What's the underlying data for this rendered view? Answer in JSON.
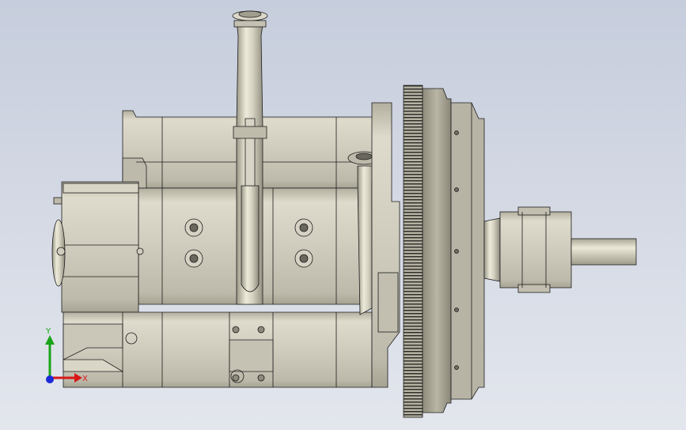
{
  "viewport": {
    "background_top": "#c6cddc",
    "background_bottom": "#e3e6ed",
    "model_body_color": "#c9c6b6",
    "model_edge_color": "#1c1c1c"
  },
  "triad": {
    "x_label": "X",
    "y_label": "Y",
    "x_color": "#d81818",
    "y_color": "#19a319",
    "z_color": "#1b2bd8"
  }
}
